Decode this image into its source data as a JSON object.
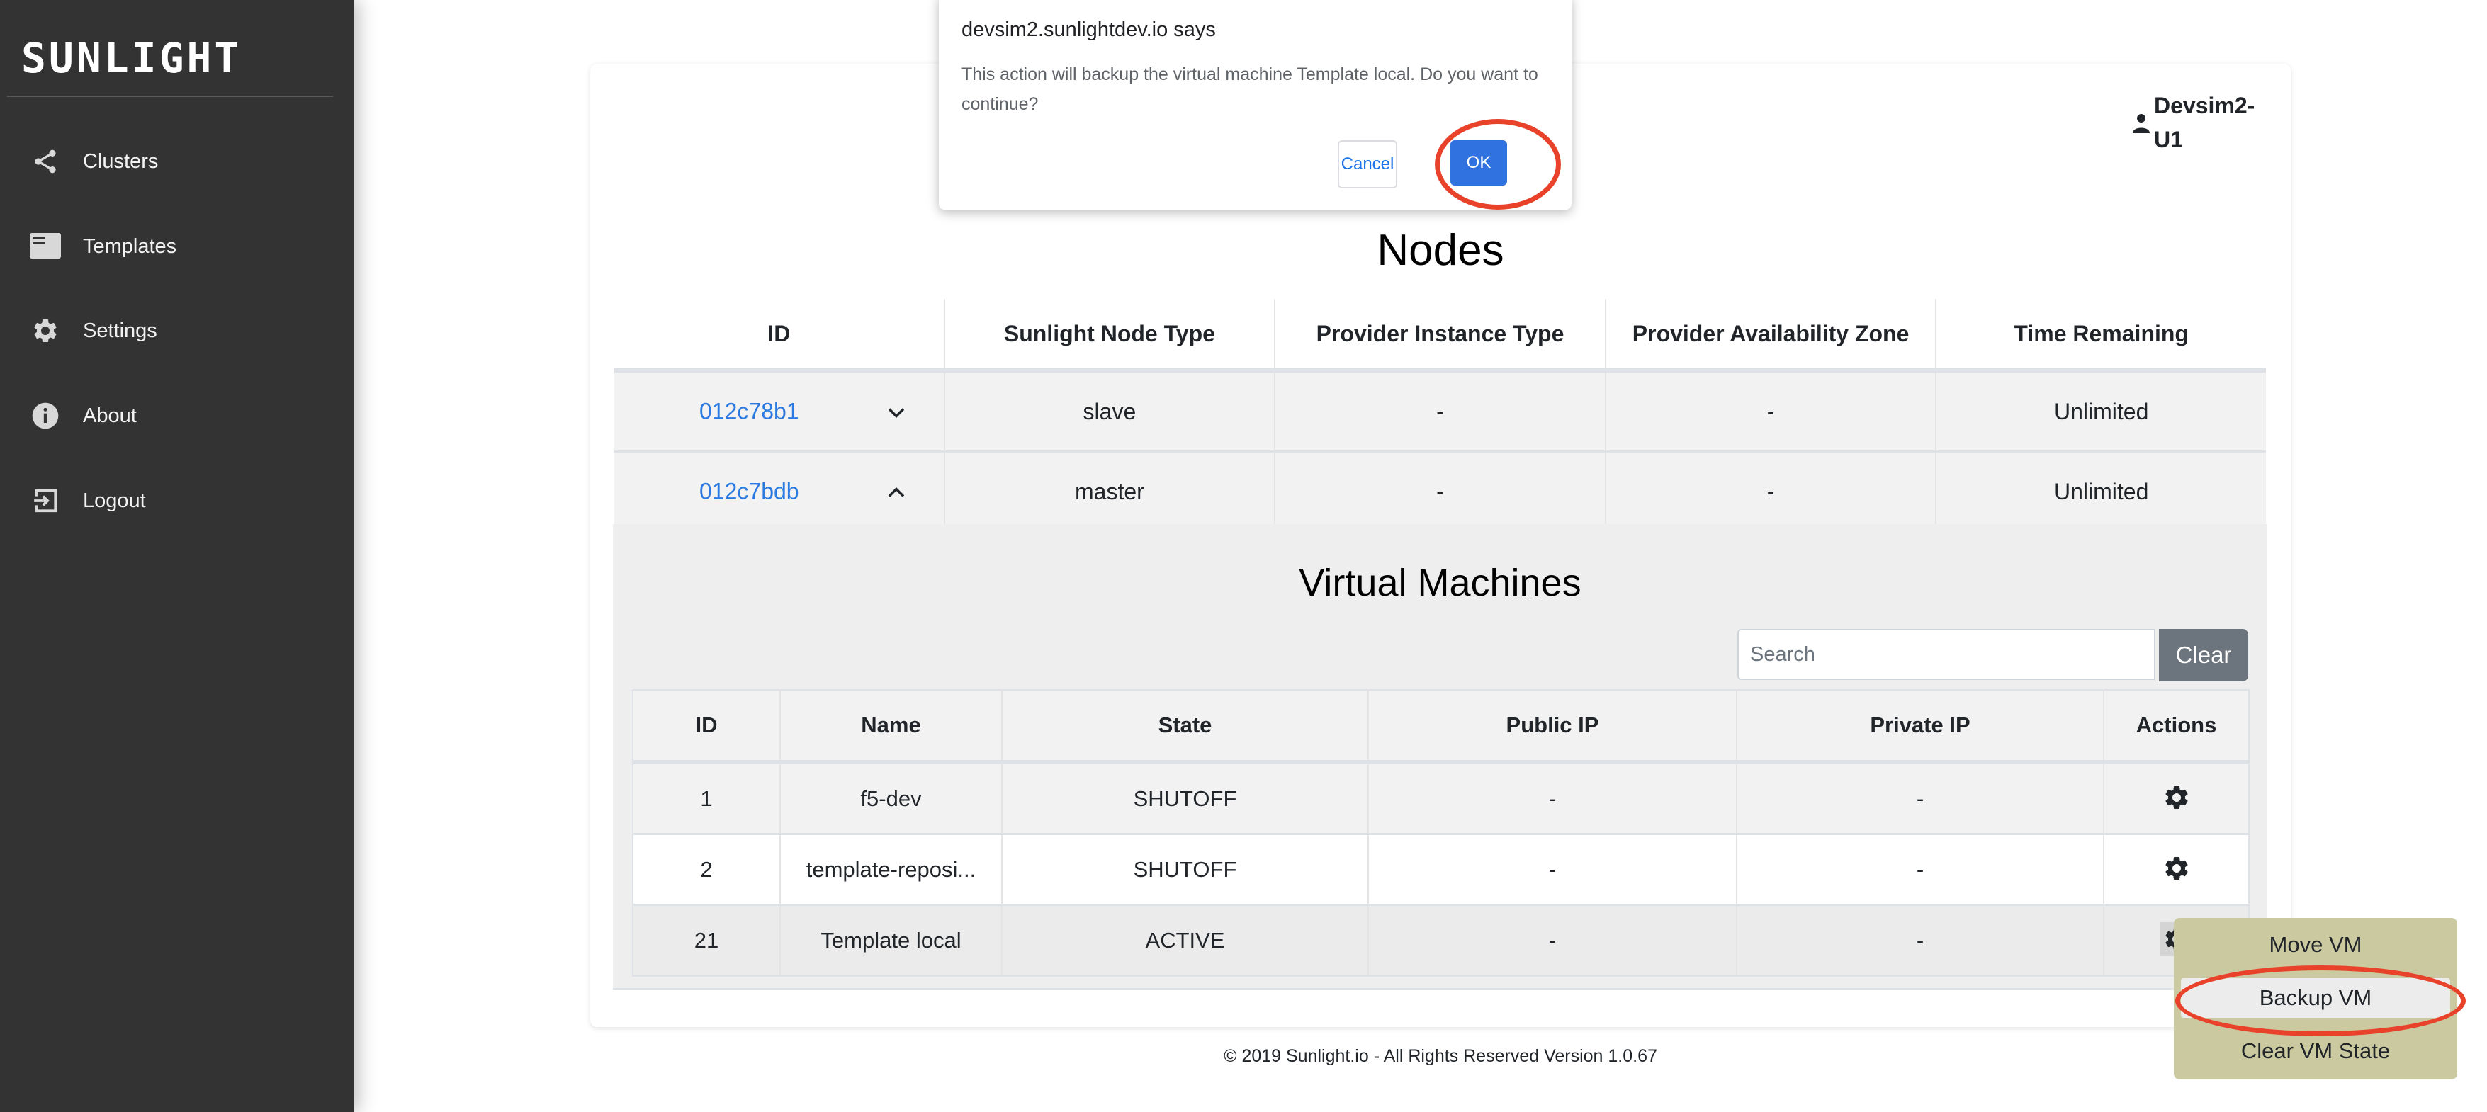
{
  "sidebar": {
    "logo": "SUNLIGHT",
    "items": [
      {
        "label": "Clusters",
        "icon": "share-icon"
      },
      {
        "label": "Templates",
        "icon": "template-icon"
      },
      {
        "label": "Settings",
        "icon": "gear-icon"
      },
      {
        "label": "About",
        "icon": "info-icon"
      },
      {
        "label": "Logout",
        "icon": "logout-icon"
      }
    ]
  },
  "user": {
    "name": "Devsim2-U1",
    "icon": "person-icon"
  },
  "nodes": {
    "title": "Nodes",
    "columns": [
      "ID",
      "Sunlight Node Type",
      "Provider Instance Type",
      "Provider Availability Zone",
      "Time Remaining"
    ],
    "rows": [
      {
        "id": "012c78b1",
        "expanded": false,
        "type": "slave",
        "instance_type": "-",
        "zone": "-",
        "time_remaining": "Unlimited"
      },
      {
        "id": "012c7bdb",
        "expanded": true,
        "type": "master",
        "instance_type": "-",
        "zone": "-",
        "time_remaining": "Unlimited"
      }
    ]
  },
  "vms": {
    "title": "Virtual Machines",
    "search_placeholder": "Search",
    "search_value": "",
    "clear_label": "Clear",
    "columns": [
      "ID",
      "Name",
      "State",
      "Public IP",
      "Private IP",
      "Actions"
    ],
    "rows": [
      {
        "id": "1",
        "name": "f5-dev",
        "state": "SHUTOFF",
        "public_ip": "-",
        "private_ip": "-"
      },
      {
        "id": "2",
        "name": "template-reposi...",
        "state": "SHUTOFF",
        "public_ip": "-",
        "private_ip": "-"
      },
      {
        "id": "21",
        "name": "Template local",
        "state": "ACTIVE",
        "public_ip": "-",
        "private_ip": "-"
      }
    ]
  },
  "context_menu": {
    "items": [
      "Move VM",
      "Backup VM",
      "Clear VM State"
    ],
    "highlighted": "Backup VM"
  },
  "dialog": {
    "title": "devsim2.sunlightdev.io says",
    "message": "This action will backup the virtual machine Template local. Do you want to continue?",
    "cancel_label": "Cancel",
    "ok_label": "OK"
  },
  "footer": {
    "text": "© 2019 Sunlight.io - All Rights Reserved Version 1.0.67"
  },
  "colors": {
    "sidebar_bg": "#333333",
    "link": "#2a7ae2",
    "ok_button": "#2f72e0",
    "annotation": "#e8432a",
    "menu_bg": "#cbc9a0"
  }
}
